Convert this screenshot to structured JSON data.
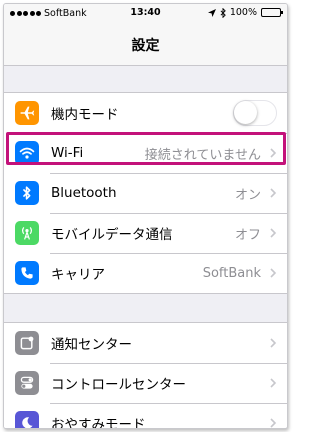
{
  "status_bar": {
    "carrier": "SoftBank",
    "time": "13:40",
    "battery": "100%"
  },
  "nav": {
    "title": "設定"
  },
  "groups": [
    {
      "rows": [
        {
          "label": "機内モード",
          "icon": "airplane-icon",
          "icon_color": "#ff9500",
          "control": "toggle",
          "toggle_on": false
        },
        {
          "label": "Wi-Fi",
          "icon": "wifi-icon",
          "icon_color": "#007aff",
          "value": "接続されていません",
          "highlighted": true
        },
        {
          "label": "Bluetooth",
          "icon": "bluetooth-icon",
          "icon_color": "#007aff",
          "value": "オン"
        },
        {
          "label": "モバイルデータ通信",
          "icon": "cellular-icon",
          "icon_color": "#4cd964",
          "value": "オフ"
        },
        {
          "label": "キャリア",
          "icon": "phone-icon",
          "icon_color": "#007aff",
          "value": "SoftBank"
        }
      ]
    },
    {
      "rows": [
        {
          "label": "通知センター",
          "icon": "notification-center-icon",
          "icon_color": "#8e8e93"
        },
        {
          "label": "コントロールセンター",
          "icon": "control-center-icon",
          "icon_color": "#8e8e93"
        },
        {
          "label": "おやすみモード",
          "icon": "moon-icon",
          "icon_color": "#5856d6"
        }
      ]
    }
  ],
  "colors": {
    "highlight_border": "#c3127a",
    "background": "#efeff4",
    "secondary_text": "#8e8e93"
  }
}
